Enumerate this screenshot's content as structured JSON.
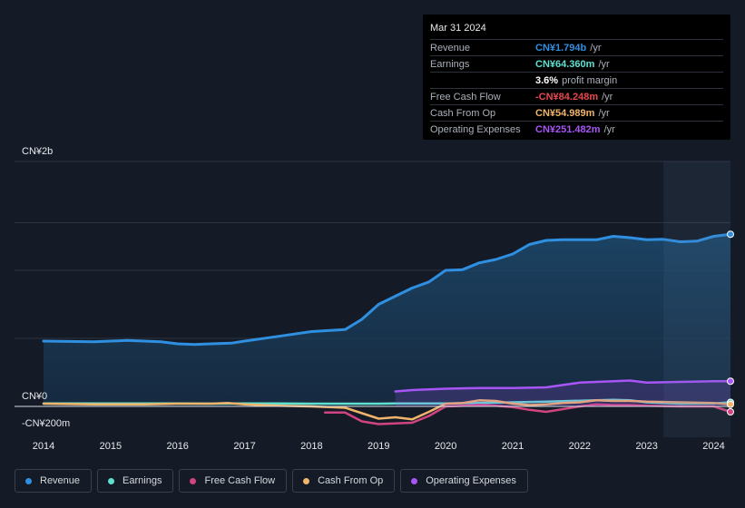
{
  "tooltip": {
    "date": "Mar 31 2024",
    "rows": [
      {
        "name": "Revenue",
        "value": "CN¥1.794b",
        "unit": "/yr",
        "color": "#2f8fe0"
      },
      {
        "name": "Earnings",
        "value": "CN¥64.360m",
        "unit": "/yr",
        "color": "#5fe0d0"
      },
      {
        "name": "",
        "value": "3.6%",
        "unit": "profit margin",
        "color": "#ffffff"
      },
      {
        "name": "Free Cash Flow",
        "value": "-CN¥84.248m",
        "unit": "/yr",
        "color": "#e8484f"
      },
      {
        "name": "Cash From Op",
        "value": "CN¥54.989m",
        "unit": "/yr",
        "color": "#f0b56a"
      },
      {
        "name": "Operating Expenses",
        "value": "CN¥251.482m",
        "unit": "/yr",
        "color": "#a855f7"
      }
    ]
  },
  "legend": [
    {
      "label": "Revenue",
      "color": "#2f8fe0"
    },
    {
      "label": "Earnings",
      "color": "#5fe0d0"
    },
    {
      "label": "Free Cash Flow",
      "color": "#d0457f"
    },
    {
      "label": "Cash From Op",
      "color": "#f0b56a"
    },
    {
      "label": "Operating Expenses",
      "color": "#a855f7"
    }
  ],
  "chart_data": {
    "type": "area",
    "y_axis_labels": {
      "top": "CN¥2b",
      "zero": "CN¥0",
      "bottom": "-CN¥200m"
    },
    "ylim": [
      -200,
      1800
    ],
    "xlim": [
      2014.0,
      2024.25
    ],
    "x_ticks": [
      "2014",
      "2015",
      "2016",
      "2017",
      "2018",
      "2019",
      "2020",
      "2021",
      "2022",
      "2023",
      "2024"
    ],
    "series": [
      {
        "name": "Revenue",
        "color": "#2f8fe0",
        "area": true,
        "points": [
          [
            2014.0,
            480
          ],
          [
            2014.75,
            475
          ],
          [
            2015.25,
            485
          ],
          [
            2015.75,
            475
          ],
          [
            2016.0,
            460
          ],
          [
            2016.25,
            455
          ],
          [
            2016.5,
            460
          ],
          [
            2016.8,
            465
          ],
          [
            2017.0,
            480
          ],
          [
            2017.5,
            515
          ],
          [
            2018.0,
            550
          ],
          [
            2018.5,
            565
          ],
          [
            2018.75,
            640
          ],
          [
            2019.0,
            750
          ],
          [
            2019.25,
            810
          ],
          [
            2019.5,
            870
          ],
          [
            2019.75,
            915
          ],
          [
            2020.0,
            1000
          ],
          [
            2020.25,
            1005
          ],
          [
            2020.5,
            1055
          ],
          [
            2020.75,
            1080
          ],
          [
            2021.0,
            1120
          ],
          [
            2021.25,
            1190
          ],
          [
            2021.5,
            1220
          ],
          [
            2021.75,
            1225
          ],
          [
            2022.0,
            1225
          ],
          [
            2022.25,
            1225
          ],
          [
            2022.5,
            1250
          ],
          [
            2022.75,
            1240
          ],
          [
            2023.0,
            1225
          ],
          [
            2023.25,
            1228
          ],
          [
            2023.5,
            1210
          ],
          [
            2023.75,
            1215
          ],
          [
            2024.0,
            1250
          ],
          [
            2024.25,
            1265
          ]
        ]
      },
      {
        "name": "Earnings",
        "color": "#5fe0d0",
        "area": false,
        "points": [
          [
            2014.0,
            22
          ],
          [
            2014.75,
            22
          ],
          [
            2015.5,
            22
          ],
          [
            2016.0,
            22
          ],
          [
            2016.5,
            20
          ],
          [
            2017.0,
            22
          ],
          [
            2017.5,
            22
          ],
          [
            2018.0,
            20
          ],
          [
            2018.5,
            20
          ],
          [
            2019.0,
            20
          ],
          [
            2019.25,
            22
          ],
          [
            2019.5,
            22
          ],
          [
            2020.0,
            22
          ],
          [
            2020.5,
            25
          ],
          [
            2021.0,
            30
          ],
          [
            2021.5,
            35
          ],
          [
            2022.0,
            42
          ],
          [
            2022.5,
            48
          ],
          [
            2022.75,
            45
          ],
          [
            2023.0,
            30
          ],
          [
            2023.5,
            20
          ],
          [
            2024.0,
            22
          ],
          [
            2024.25,
            30
          ]
        ]
      },
      {
        "name": "Free Cash Flow",
        "color": "#d0457f",
        "area": false,
        "points": [
          [
            2018.2,
            -45
          ],
          [
            2018.5,
            -45
          ],
          [
            2018.75,
            -110
          ],
          [
            2019.0,
            -130
          ],
          [
            2019.25,
            -125
          ],
          [
            2019.5,
            -120
          ],
          [
            2019.75,
            -70
          ],
          [
            2020.0,
            0
          ],
          [
            2020.25,
            5
          ],
          [
            2020.5,
            12
          ],
          [
            2020.75,
            5
          ],
          [
            2021.0,
            -5
          ],
          [
            2021.25,
            -25
          ],
          [
            2021.5,
            -40
          ],
          [
            2021.75,
            -20
          ],
          [
            2022.0,
            0
          ],
          [
            2022.25,
            15
          ],
          [
            2022.5,
            10
          ],
          [
            2022.75,
            10
          ],
          [
            2023.0,
            5
          ],
          [
            2023.5,
            0
          ],
          [
            2024.0,
            0
          ],
          [
            2024.25,
            -40
          ]
        ]
      },
      {
        "name": "Cash From Op",
        "color": "#f0b56a",
        "area": false,
        "points": [
          [
            2014.0,
            20
          ],
          [
            2014.75,
            15
          ],
          [
            2015.0,
            15
          ],
          [
            2015.5,
            15
          ],
          [
            2016.0,
            20
          ],
          [
            2016.5,
            20
          ],
          [
            2016.75,
            25
          ],
          [
            2017.0,
            15
          ],
          [
            2017.5,
            5
          ],
          [
            2018.0,
            0
          ],
          [
            2018.25,
            -5
          ],
          [
            2018.5,
            -10
          ],
          [
            2018.75,
            -50
          ],
          [
            2019.0,
            -90
          ],
          [
            2019.25,
            -80
          ],
          [
            2019.5,
            -95
          ],
          [
            2019.75,
            -40
          ],
          [
            2020.0,
            20
          ],
          [
            2020.25,
            25
          ],
          [
            2020.5,
            45
          ],
          [
            2020.75,
            40
          ],
          [
            2021.0,
            20
          ],
          [
            2021.25,
            10
          ],
          [
            2021.5,
            15
          ],
          [
            2021.75,
            25
          ],
          [
            2022.0,
            30
          ],
          [
            2022.25,
            45
          ],
          [
            2022.5,
            40
          ],
          [
            2022.75,
            40
          ],
          [
            2023.0,
            35
          ],
          [
            2023.5,
            30
          ],
          [
            2024.0,
            25
          ],
          [
            2024.25,
            15
          ]
        ]
      },
      {
        "name": "Operating Expenses",
        "color": "#a855f7",
        "area": true,
        "points": [
          [
            2019.25,
            110
          ],
          [
            2019.5,
            120
          ],
          [
            2019.75,
            125
          ],
          [
            2020.0,
            130
          ],
          [
            2020.5,
            135
          ],
          [
            2021.0,
            135
          ],
          [
            2021.5,
            140
          ],
          [
            2022.0,
            175
          ],
          [
            2022.5,
            185
          ],
          [
            2022.75,
            190
          ],
          [
            2023.0,
            175
          ],
          [
            2023.5,
            180
          ],
          [
            2024.0,
            185
          ],
          [
            2024.25,
            185
          ]
        ]
      }
    ]
  }
}
